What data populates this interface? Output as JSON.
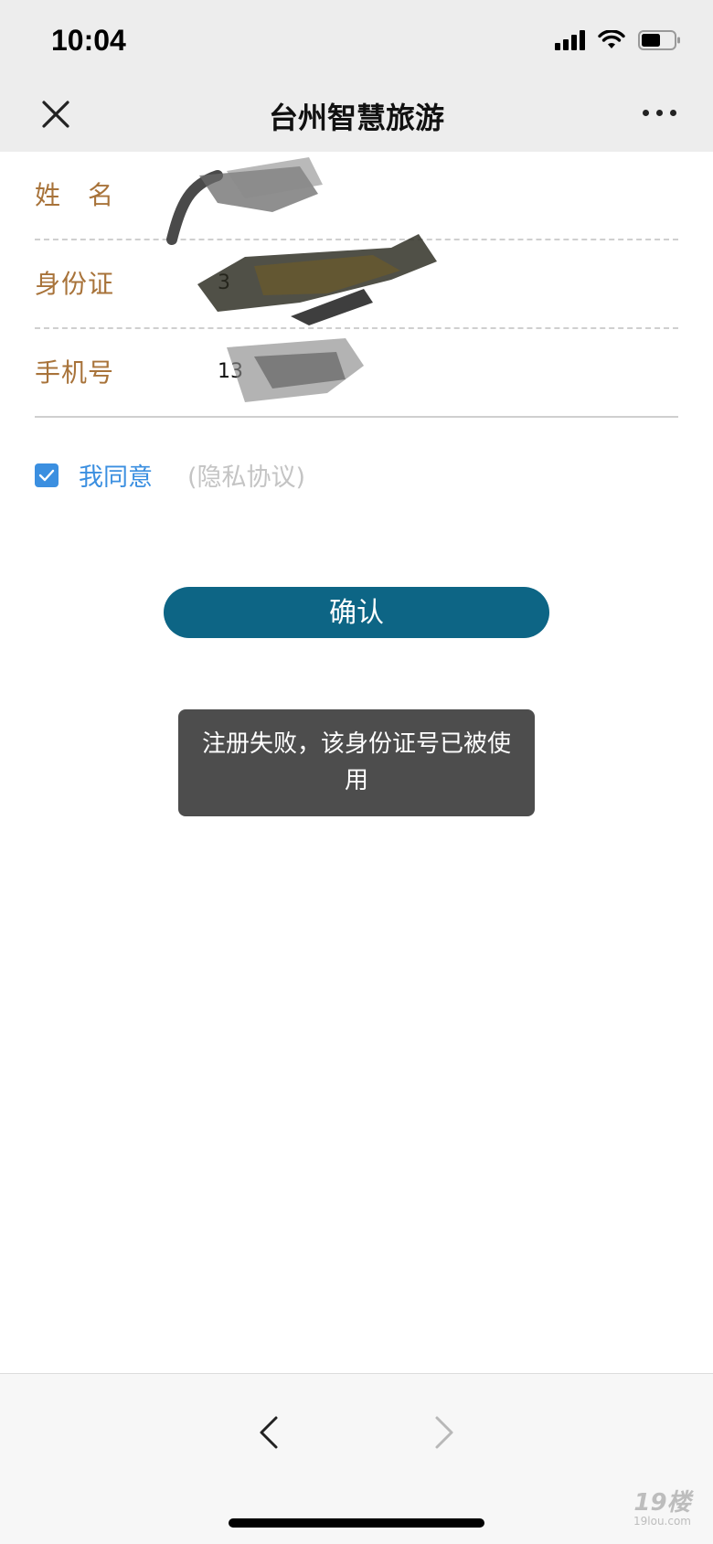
{
  "status_bar": {
    "time": "10:04"
  },
  "nav": {
    "title": "台州智慧旅游"
  },
  "form": {
    "rows": [
      {
        "label": "姓　名",
        "value": ""
      },
      {
        "label": "身份证",
        "value": "3"
      },
      {
        "label": "手机号",
        "value": "13"
      }
    ]
  },
  "agreement": {
    "checked": true,
    "label": "我同意",
    "link": "(隐私协议)"
  },
  "confirm_button": {
    "label": "确认"
  },
  "toast": {
    "message": "注册失败，该身份证号已被使用"
  },
  "watermark": {
    "brand": "19楼",
    "domain": "19lou.com"
  },
  "colors": {
    "label": "#a8733a",
    "accent_blue": "#3b8fe0",
    "button": "#0d6585",
    "toast_bg": "#4d4d4d"
  }
}
